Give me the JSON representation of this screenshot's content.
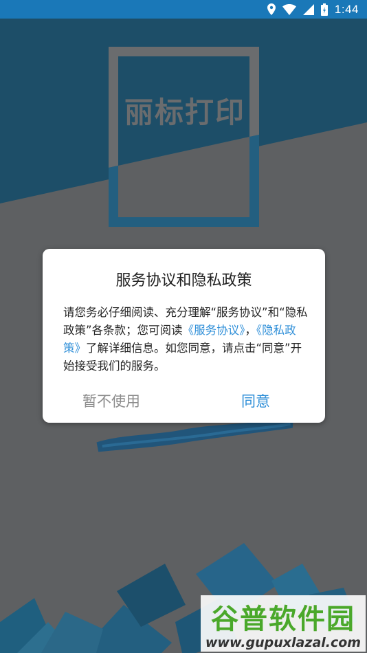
{
  "status_bar": {
    "time": "1:44",
    "icons": [
      "location-icon",
      "wifi-icon",
      "signal-icon",
      "battery-icon"
    ]
  },
  "splash": {
    "logo_text": "丽标打印"
  },
  "dialog": {
    "title": "服务协议和隐私政策",
    "body_text_1": "请您务必仔细阅读、充分理解“服务协议”和“隐私政策”各条款；您可阅读",
    "link_service": "《服务协议》",
    "separator": "，",
    "link_privacy": "《隐私政策》",
    "body_text_2": "了解详细信息。如您同意，请点击“同意”开始接受我们的服务。",
    "decline_label": "暂不使用",
    "agree_label": "同意"
  },
  "watermark": {
    "title": "谷普软件园",
    "url": "www.gupuxlazal.com"
  },
  "colors": {
    "status_bar": "#1a78b8",
    "accent": "#2f8fd8",
    "backdrop": "#5e6062",
    "watermark_green": "#4aa82a"
  }
}
